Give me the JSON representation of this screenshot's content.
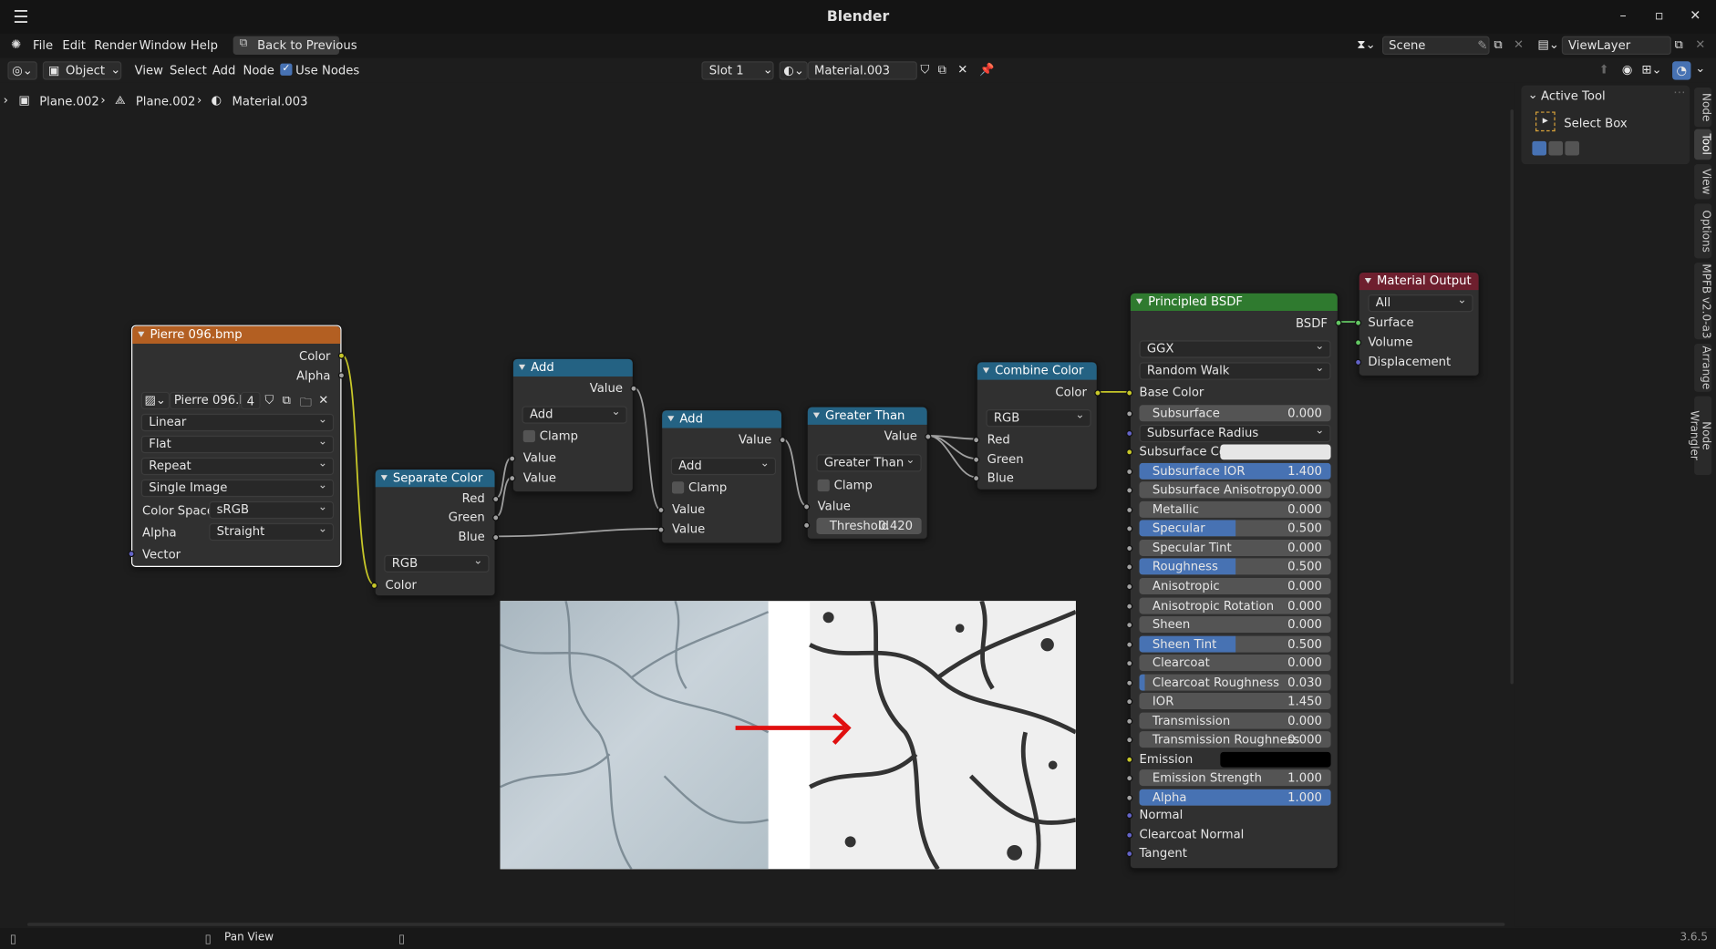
{
  "window": {
    "title": "Blender",
    "min": "–",
    "max": "▫",
    "close": "✕"
  },
  "menu": {
    "items": [
      "File",
      "Edit",
      "Render",
      "Window",
      "Help"
    ],
    "back": "Back to Previous",
    "scene": "Scene",
    "view_layer": "ViewLayer"
  },
  "header": {
    "mode": "Object",
    "items": [
      "View",
      "Select",
      "Add",
      "Node"
    ],
    "use_nodes": "Use Nodes",
    "slot": "Slot 1",
    "material": "Material.003"
  },
  "breadcrumb": [
    "Plane.002",
    "Plane.002",
    "Material.003"
  ],
  "nodes": {
    "image": {
      "title": "Pierre 096.bmp",
      "out_color": "Color",
      "out_alpha": "Alpha",
      "img_name": "Pierre 096.b...",
      "users": "4",
      "interp": "Linear",
      "proj": "Flat",
      "ext": "Repeat",
      "src": "Single Image",
      "cs_label": "Color Space",
      "cs": "sRGB",
      "alpha_label": "Alpha",
      "alpha": "Straight",
      "vector": "Vector"
    },
    "sep": {
      "title": "Separate Color",
      "red": "Red",
      "green": "Green",
      "blue": "Blue",
      "mode": "RGB",
      "color": "Color"
    },
    "add1": {
      "title": "Add",
      "out": "Value",
      "op": "Add",
      "clamp": "Clamp",
      "in1": "Value",
      "in2": "Value"
    },
    "add2": {
      "title": "Add",
      "out": "Value",
      "op": "Add",
      "clamp": "Clamp",
      "in1": "Value",
      "in2": "Value"
    },
    "gt": {
      "title": "Greater Than",
      "out": "Value",
      "op": "Greater Than",
      "clamp": "Clamp",
      "in": "Value",
      "thr_label": "Threshold",
      "thr": "0.420"
    },
    "comb": {
      "title": "Combine Color",
      "out": "Color",
      "mode": "RGB",
      "red": "Red",
      "green": "Green",
      "blue": "Blue"
    },
    "bsdf": {
      "title": "Principled BSDF",
      "out": "BSDF",
      "dist": "GGX",
      "ss_method": "Random Walk",
      "base": "Base Color",
      "rows": [
        {
          "l": "Subsurface",
          "v": "0.000",
          "f": 0
        },
        {
          "l": "Subsurface Radius",
          "v": "",
          "dd": true
        },
        {
          "l": "Subsurface Co...",
          "v": "",
          "swatch": "#e6e6e6"
        },
        {
          "l": "Subsurface IOR",
          "v": "1.400",
          "f": 1
        },
        {
          "l": "Subsurface Anisotropy",
          "v": "0.000",
          "f": 0
        },
        {
          "l": "Metallic",
          "v": "0.000",
          "f": 0
        },
        {
          "l": "Specular",
          "v": "0.500",
          "f": 0.5
        },
        {
          "l": "Specular Tint",
          "v": "0.000",
          "f": 0
        },
        {
          "l": "Roughness",
          "v": "0.500",
          "f": 0.5
        },
        {
          "l": "Anisotropic",
          "v": "0.000",
          "f": 0
        },
        {
          "l": "Anisotropic Rotation",
          "v": "0.000",
          "f": 0
        },
        {
          "l": "Sheen",
          "v": "0.000",
          "f": 0
        },
        {
          "l": "Sheen Tint",
          "v": "0.500",
          "f": 0.5
        },
        {
          "l": "Clearcoat",
          "v": "0.000",
          "f": 0
        },
        {
          "l": "Clearcoat Roughness",
          "v": "0.030",
          "f": 0.03
        },
        {
          "l": "IOR",
          "v": "1.450",
          "f": 0
        },
        {
          "l": "Transmission",
          "v": "0.000",
          "f": 0
        },
        {
          "l": "Transmission Roughness",
          "v": "0.000",
          "f": 0
        },
        {
          "l": "Emission",
          "v": "",
          "swatch": "#000000"
        },
        {
          "l": "Emission Strength",
          "v": "1.000",
          "f": 0
        },
        {
          "l": "Alpha",
          "v": "1.000",
          "f": 1
        }
      ],
      "normal": "Normal",
      "cc_normal": "Clearcoat Normal",
      "tangent": "Tangent"
    },
    "out": {
      "title": "Material Output",
      "target": "All",
      "surface": "Surface",
      "volume": "Volume",
      "disp": "Displacement"
    }
  },
  "side": {
    "active_tool": "Active Tool",
    "tool": "Select Box",
    "tabs": [
      "Node",
      "Tool",
      "View",
      "Options",
      "MPFB v2.0-a3",
      "Arrange",
      "Node Wrangler"
    ]
  },
  "status": {
    "pan": "Pan View",
    "version": "3.6.5"
  },
  "colors": {
    "accent": "#4772b3",
    "image_hdr": "#b35f22",
    "conv_hdr": "#246283",
    "shader_hdr": "#2f7a2f",
    "output_hdr": "#6e1f2e"
  }
}
